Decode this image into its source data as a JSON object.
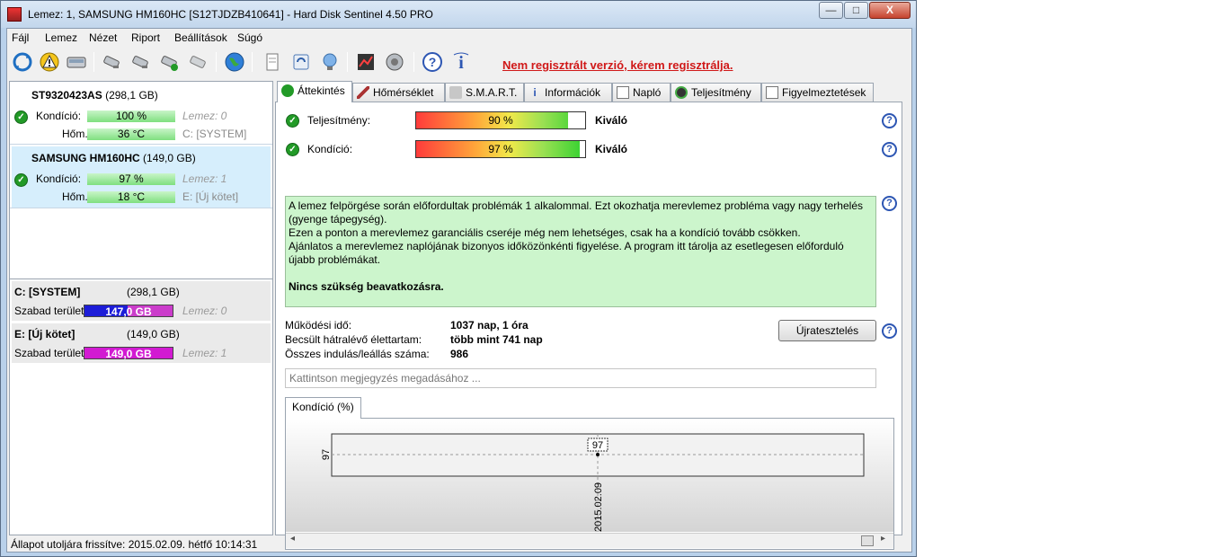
{
  "window": {
    "title": "Lemez: 1, SAMSUNG HM160HC [S12TJDZB410641]  -  Hard Disk Sentinel 4.50 PRO",
    "min_label": "—",
    "max_label": "□",
    "close_label": "X"
  },
  "menu": {
    "items": [
      "Fájl",
      "Lemez",
      "Nézet",
      "Riport",
      "Beállítások",
      "Súgó"
    ]
  },
  "toolbar": {
    "icons": [
      "refresh-icon",
      "warning-icon",
      "disk-icon",
      "usb-disk-icon",
      "usb-disk-icon",
      "usb-disk-ok-icon",
      "usb-disk-off-icon",
      "globe-icon",
      "document-icon",
      "sync-icon",
      "network-icon",
      "chart-icon",
      "speaker-icon",
      "help-icon",
      "info-icon"
    ],
    "registration_text": "Nem regisztrált verzió, kérem regisztrálja."
  },
  "disks": [
    {
      "model": "ST9320423AS",
      "size": "(298,1 GB)",
      "condition_label": "Kondíció:",
      "condition_value": "100 %",
      "condition_level": 100,
      "disk_label": "Lemez: 0",
      "temp_label": "Hőm.:",
      "temp_value": "36 °C",
      "volume": "C: [SYSTEM]"
    },
    {
      "model": "SAMSUNG HM160HC",
      "size": "(149,0 GB)",
      "condition_label": "Kondíció:",
      "condition_value": "97 %",
      "condition_level": 97,
      "disk_label": "Lemez: 1",
      "temp_label": "Hőm.:",
      "temp_value": "18 °C",
      "volume": "E: [Új kötet]"
    }
  ],
  "volumes": [
    {
      "name": "C: [SYSTEM]",
      "size": "(298,1 GB)",
      "free_label": "Szabad terület",
      "free_value": "147,0 GB",
      "free_fraction": 0.49,
      "disk_label": "Lemez: 0"
    },
    {
      "name": "E: [Új kötet]",
      "size": "(149,0 GB)",
      "free_label": "Szabad terület",
      "free_value": "149,0 GB",
      "free_fraction": 1.0,
      "disk_label": "Lemez: 1"
    }
  ],
  "tabs": [
    "Áttekintés",
    "Hőmérséklet",
    "S.M.A.R.T.",
    "Információk",
    "Napló",
    "Teljesítmény",
    "Figyelmeztetések"
  ],
  "overview": {
    "performance_label": "Teljesítmény:",
    "performance_value": "90 %",
    "performance_level": 90,
    "performance_rating": "Kiváló",
    "condition_label": "Kondíció:",
    "condition_value": "97 %",
    "condition_level": 97,
    "condition_rating": "Kiváló",
    "message_lines": [
      "A lemez felpörgése során előfordultak problémák 1 alkalommal. Ezt okozhatja merevlemez probléma vagy nagy terhelés (gyenge tápegység).",
      "Ezen a ponton a merevlemez garanciális cseréje még nem lehetséges, csak ha a kondíció tovább csökken.",
      "Ajánlatos a merevlemez naplójának bizonyos időközönkénti figyelése. A program itt tárolja az esetlegesen előforduló újabb problémákat."
    ],
    "message_bold": "Nincs szükség beavatkozásra.",
    "uptime_label": "Működési idő:",
    "uptime_value": "1037 nap, 1 óra",
    "remaining_label": "Becsült hátralévő élettartam:",
    "remaining_value": "több mint 741 nap",
    "startstop_label": "Összes indulás/leállás száma:",
    "startstop_value": "986",
    "retest_button": "Újratesztelés",
    "note_placeholder": "Kattintson megjegyzés megadásához ...",
    "help_label": "?"
  },
  "chart_tab": "Kondíció  (%)",
  "chart_data": {
    "type": "line",
    "x": [
      "2015.02.09"
    ],
    "series": [
      {
        "values": [
          97
        ]
      }
    ],
    "ytick": "97",
    "data_label": "97"
  },
  "status": {
    "text": "Állapot utoljára frissítve: 2015.02.09. hétfő 10:14:31"
  },
  "colors": {
    "registration": "#d01818",
    "ok_green": "#229a27",
    "free_blue": "#1d1dd8",
    "free_magenta": "#d21ad2"
  }
}
